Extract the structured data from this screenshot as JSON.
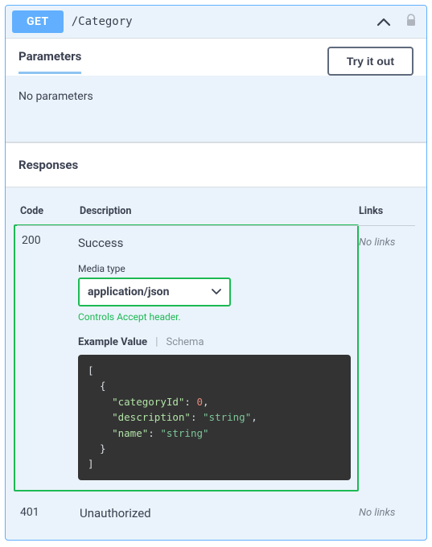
{
  "operation": {
    "method": "GET",
    "path": "/Category"
  },
  "parameters": {
    "title": "Parameters",
    "try_label": "Try it out",
    "empty_text": "No parameters"
  },
  "responses": {
    "title": "Responses",
    "headers": {
      "code": "Code",
      "description": "Description",
      "links": "Links"
    },
    "rows": [
      {
        "code": "200",
        "description": "Success",
        "links": "No links",
        "media_type_label": "Media type",
        "media_type_value": "application/json",
        "controls_hint": "Controls Accept header.",
        "tab_example": "Example Value",
        "tab_schema": "Schema",
        "example": {
          "open": "[",
          "obj_open": "  {",
          "k1": "\"categoryId\"",
          "v1": "0",
          "k2": "\"description\"",
          "v2": "\"string\"",
          "k3": "\"name\"",
          "v3": "\"string\"",
          "obj_close": "  }",
          "close": "]"
        }
      },
      {
        "code": "401",
        "description": "Unauthorized",
        "links": "No links"
      }
    ]
  }
}
